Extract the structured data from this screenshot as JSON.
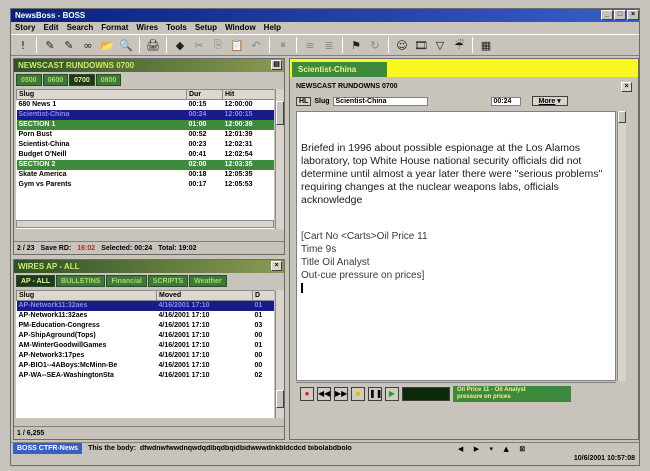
{
  "window": {
    "title": "NewsBoss - BOSS",
    "controls": [
      "_",
      "□",
      "×"
    ]
  },
  "menu": [
    "Story",
    "Edit",
    "Search",
    "Format",
    "Wires",
    "Tools",
    "Setup",
    "Window",
    "Help"
  ],
  "toolbar": {
    "icons": [
      "exclaim-icon",
      "new-story-icon",
      "edit-story-icon",
      "link-icon",
      "open-icon",
      "find-icon",
      "print-icon",
      "eraser-icon",
      "cut-icon",
      "copy-icon",
      "paste-icon",
      "undo-icon",
      "pause-icon",
      "align-left-icon",
      "align-center-icon",
      "flag-icon",
      "refresh-icon",
      "user-icon",
      "film-icon",
      "filter-icon",
      "wire-filter-icon",
      "grid-icon"
    ],
    "glyphs": [
      "!",
      "✎",
      "✎",
      "∞",
      "📂",
      "🔍",
      "🖨",
      "◆",
      "✂",
      "⎘",
      "📋",
      "↶",
      "⏸",
      "≡",
      "≣",
      "⚑",
      "↻",
      "☺",
      "🎞",
      "▽",
      "☔",
      "▦"
    ]
  },
  "rundown": {
    "title": "NEWSCAST RUNDOWNS 0700",
    "tabs": [
      "0500",
      "0600",
      "0700",
      "0800"
    ],
    "active_tab": 2,
    "columns": [
      "Slug",
      "Dur",
      "Hit"
    ],
    "rows": [
      {
        "slug": "680 News 1",
        "dur": "00:15",
        "hit": "12:00:00",
        "type": "normal"
      },
      {
        "slug": "Scientist-China",
        "dur": "00:24",
        "hit": "12:00:15",
        "type": "selected"
      },
      {
        "slug": "SECTION 1",
        "dur": "01:00",
        "hit": "12:00:39",
        "type": "section"
      },
      {
        "slug": "Porn Bust",
        "dur": "00:52",
        "hit": "12:01:39",
        "type": "normal"
      },
      {
        "slug": "Scientist-China",
        "dur": "00:23",
        "hit": "12:02:31",
        "type": "normal"
      },
      {
        "slug": "Budget O'Neill",
        "dur": "00:41",
        "hit": "12:02:54",
        "type": "normal"
      },
      {
        "slug": "SECTION 2",
        "dur": "02:00",
        "hit": "12:03:35",
        "type": "section"
      },
      {
        "slug": "Skate America",
        "dur": "00:18",
        "hit": "12:05:35",
        "type": "normal"
      },
      {
        "slug": "Gym vs Parents",
        "dur": "00:17",
        "hit": "12:05:53",
        "type": "normal"
      }
    ],
    "status": {
      "position": "2 / 23",
      "save": "Save RD:",
      "save_value": "16:02",
      "selected": "Selected: 00:24",
      "total": "Total: 19:02"
    }
  },
  "wires": {
    "title": "WIRES AP - ALL",
    "tabs": [
      "AP - ALL",
      "BULLETINS",
      "Financial",
      "SCRIPTS",
      "Weather"
    ],
    "active_tab": 0,
    "columns": [
      "Slug",
      "Moved",
      "D"
    ],
    "rows": [
      {
        "slug": "AP-Network11:32aes",
        "moved": "4/16/2001 17:10",
        "d": "01",
        "type": "selected"
      },
      {
        "slug": "AP-Network11:32aes",
        "moved": "4/16/2001 17:10",
        "d": "01",
        "type": "normal"
      },
      {
        "slug": "PM-Education-Congress",
        "moved": "4/16/2001 17:10",
        "d": "03",
        "type": "normal"
      },
      {
        "slug": "AP-ShipAground(Tops)",
        "moved": "4/16/2001 17:10",
        "d": "00",
        "type": "normal"
      },
      {
        "slug": "AM-WinterGoodwillGames",
        "moved": "4/16/2001 17:10",
        "d": "01",
        "type": "normal"
      },
      {
        "slug": "AP-Network3:17pes",
        "moved": "4/16/2001 17:10",
        "d": "00",
        "type": "normal"
      },
      {
        "slug": "AP-BIO1--4ABoys:McMinn-Be",
        "moved": "4/16/2001 17:10",
        "d": "00",
        "type": "normal"
      },
      {
        "slug": "AP-WA--SEA-WashingtonSta",
        "moved": "4/16/2001 17:10",
        "d": "02",
        "type": "normal"
      }
    ],
    "status": {
      "position": "1 / 6,255"
    }
  },
  "editor": {
    "tab": "Scientist-China",
    "header_title": "NEWSCAST RUNDOWNS 0700",
    "hl_label": "HL",
    "slug_label": "Slug",
    "slug_value": "Scientist-China",
    "dur_value": "00:24",
    "more_label": "More",
    "story_text": "Briefed in 1996 about possible espionage at the Los Alamos laboratory, top White House national security officials did not determine until almost a year later there were ''serious problems'' requiring changes at the nuclear weapons labs, officials acknowledge",
    "cart_lines": [
      "[Cart No  <Carts>Oil Price 11",
      "Time  9s",
      "Title  Oil Analyst",
      "Out-cue  pressure on prices]"
    ],
    "transport": {
      "record": "●",
      "rewind": "◀◀",
      "forward": "▶▶",
      "stop": "■",
      "pause": "❚❚",
      "play": "▶",
      "cart_display_line1": "Oil Price 11 - Oil Analyst",
      "cart_display_line2": "pressure on prices"
    }
  },
  "footer": {
    "badge": "BOSS  CTFR-News",
    "body_label": "This the body:",
    "body_text": "dfwdnwfwwdnqwdqdlbqdbqidbidwwwdnkbldcdcd bibolabdbolo",
    "datetime": "10/6/2001 10:57:08"
  },
  "colors": {
    "panel_title_bg": "#2d5226",
    "tab_green": "#3d7a3a",
    "selected_row": "#1a1a8a",
    "section_row": "#3d8a3d",
    "editor_tab_bar": "#f8f820",
    "titlebar": "#0a1f7a"
  }
}
